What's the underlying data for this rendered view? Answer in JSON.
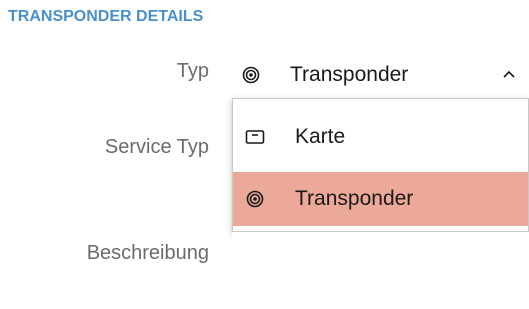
{
  "section": {
    "title": "TRANSPONDER DETAILS"
  },
  "fields": {
    "typ_label": "Typ",
    "service_typ_label": "Service Typ",
    "beschreibung_label": "Beschreibung"
  },
  "typ_select": {
    "selected_value": "Transponder",
    "selected_icon": "transponder-icon",
    "expanded": true,
    "options": [
      {
        "label": "Karte",
        "icon": "card-icon",
        "highlighted": false
      },
      {
        "label": "Transponder",
        "icon": "transponder-icon",
        "highlighted": true
      }
    ]
  },
  "colors": {
    "header": "#4a90c9",
    "highlight": "#eca898",
    "label": "#6b6b6b"
  }
}
